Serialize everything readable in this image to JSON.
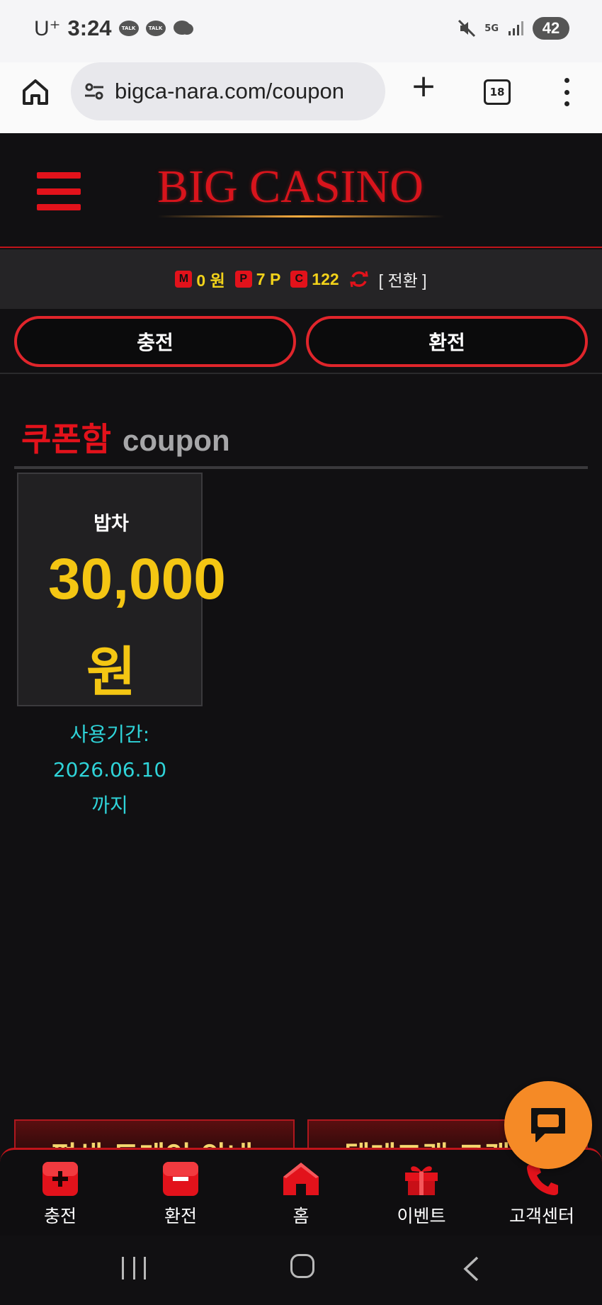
{
  "status_bar": {
    "carrier": "U⁺",
    "time": "3:24",
    "notif_icons": [
      "TALK",
      "TALK"
    ],
    "network": "5G",
    "battery": "42"
  },
  "browser": {
    "url": "bigca-nara.com/coupon",
    "tab_count": "18"
  },
  "site": {
    "logo": "BIG CASINO"
  },
  "balance": {
    "money_badge": "M",
    "money": "0 원",
    "point_badge": "P",
    "points": "7 P",
    "coin_badge": "C",
    "coins": "122",
    "switch_label": "[ 전환 ]"
  },
  "actions": {
    "deposit": "충전",
    "withdraw": "환전"
  },
  "coupon_box": {
    "title_ko": "쿠폰함",
    "title_en": "coupon",
    "coupons": [
      {
        "name": "밥차",
        "amount": "30,000",
        "unit": "원",
        "expiry_label": "사용기간:",
        "expiry_date": "2026.06.10",
        "expiry_suffix": "까지"
      }
    ]
  },
  "banners": [
    "평생 도메인 안내",
    "텔레그램 고객센터"
  ],
  "bottom_nav": [
    {
      "label": "충전",
      "icon": "plus-icon"
    },
    {
      "label": "환전",
      "icon": "minus-icon"
    },
    {
      "label": "홈",
      "icon": "home-icon"
    },
    {
      "label": "이벤트",
      "icon": "gift-icon"
    },
    {
      "label": "고객센터",
      "icon": "phone-icon"
    }
  ],
  "colors": {
    "brand_red": "#e2121b",
    "coupon_gold": "#f4c613",
    "expiry_cyan": "#2fd3d8",
    "chat_orange": "#f58a26"
  }
}
